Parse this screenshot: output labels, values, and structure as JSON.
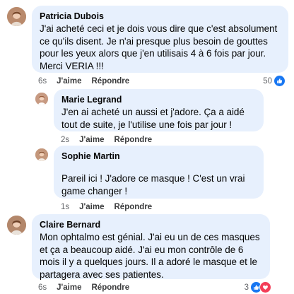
{
  "colors": {
    "bubble_bg": "#e7f0fd",
    "meta_text": "#65676b",
    "like_blue": "#1877f2",
    "love_red": "#f33e58"
  },
  "comments": [
    {
      "author": "Patricia Dubois",
      "text": "J'ai acheté ceci et je dois vous dire que c'est absolument ce qu'ils disent. Je n'ai presque plus besoin de gouttes pour les yeux alors que j'en utilisais 4 à 6 fois par jour. Merci VERIA !!!",
      "time": "6s",
      "like_label": "J'aime",
      "reply_label": "Répondre",
      "reactions_count": "50",
      "reaction_icons": [
        "like-icon"
      ]
    },
    {
      "author": "Marie Legrand",
      "text": "J'en ai acheté un aussi et j'adore. Ça a aidé tout de suite, je l'utilise une fois par jour !",
      "time": "2s",
      "like_label": "J'aime",
      "reply_label": "Répondre"
    },
    {
      "author": "Sophie Martin",
      "text": "Pareil ici ! J'adore ce masque ! C'est un vrai game changer !",
      "time": "1s",
      "like_label": "J'aime",
      "reply_label": "Répondre"
    },
    {
      "author": "Claire Bernard",
      "text": "Mon ophtalmo est génial. J'ai eu un de ces masques et ça a beaucoup aidé. J'ai eu mon contrôle de 6 mois il y a quelques jours. Il a adoré le masque et le partagera avec ses patientes.",
      "time": "6s",
      "like_label": "J'aime",
      "reply_label": "Répondre",
      "reactions_count": "3",
      "reaction_icons": [
        "like-icon",
        "love-icon"
      ]
    }
  ]
}
